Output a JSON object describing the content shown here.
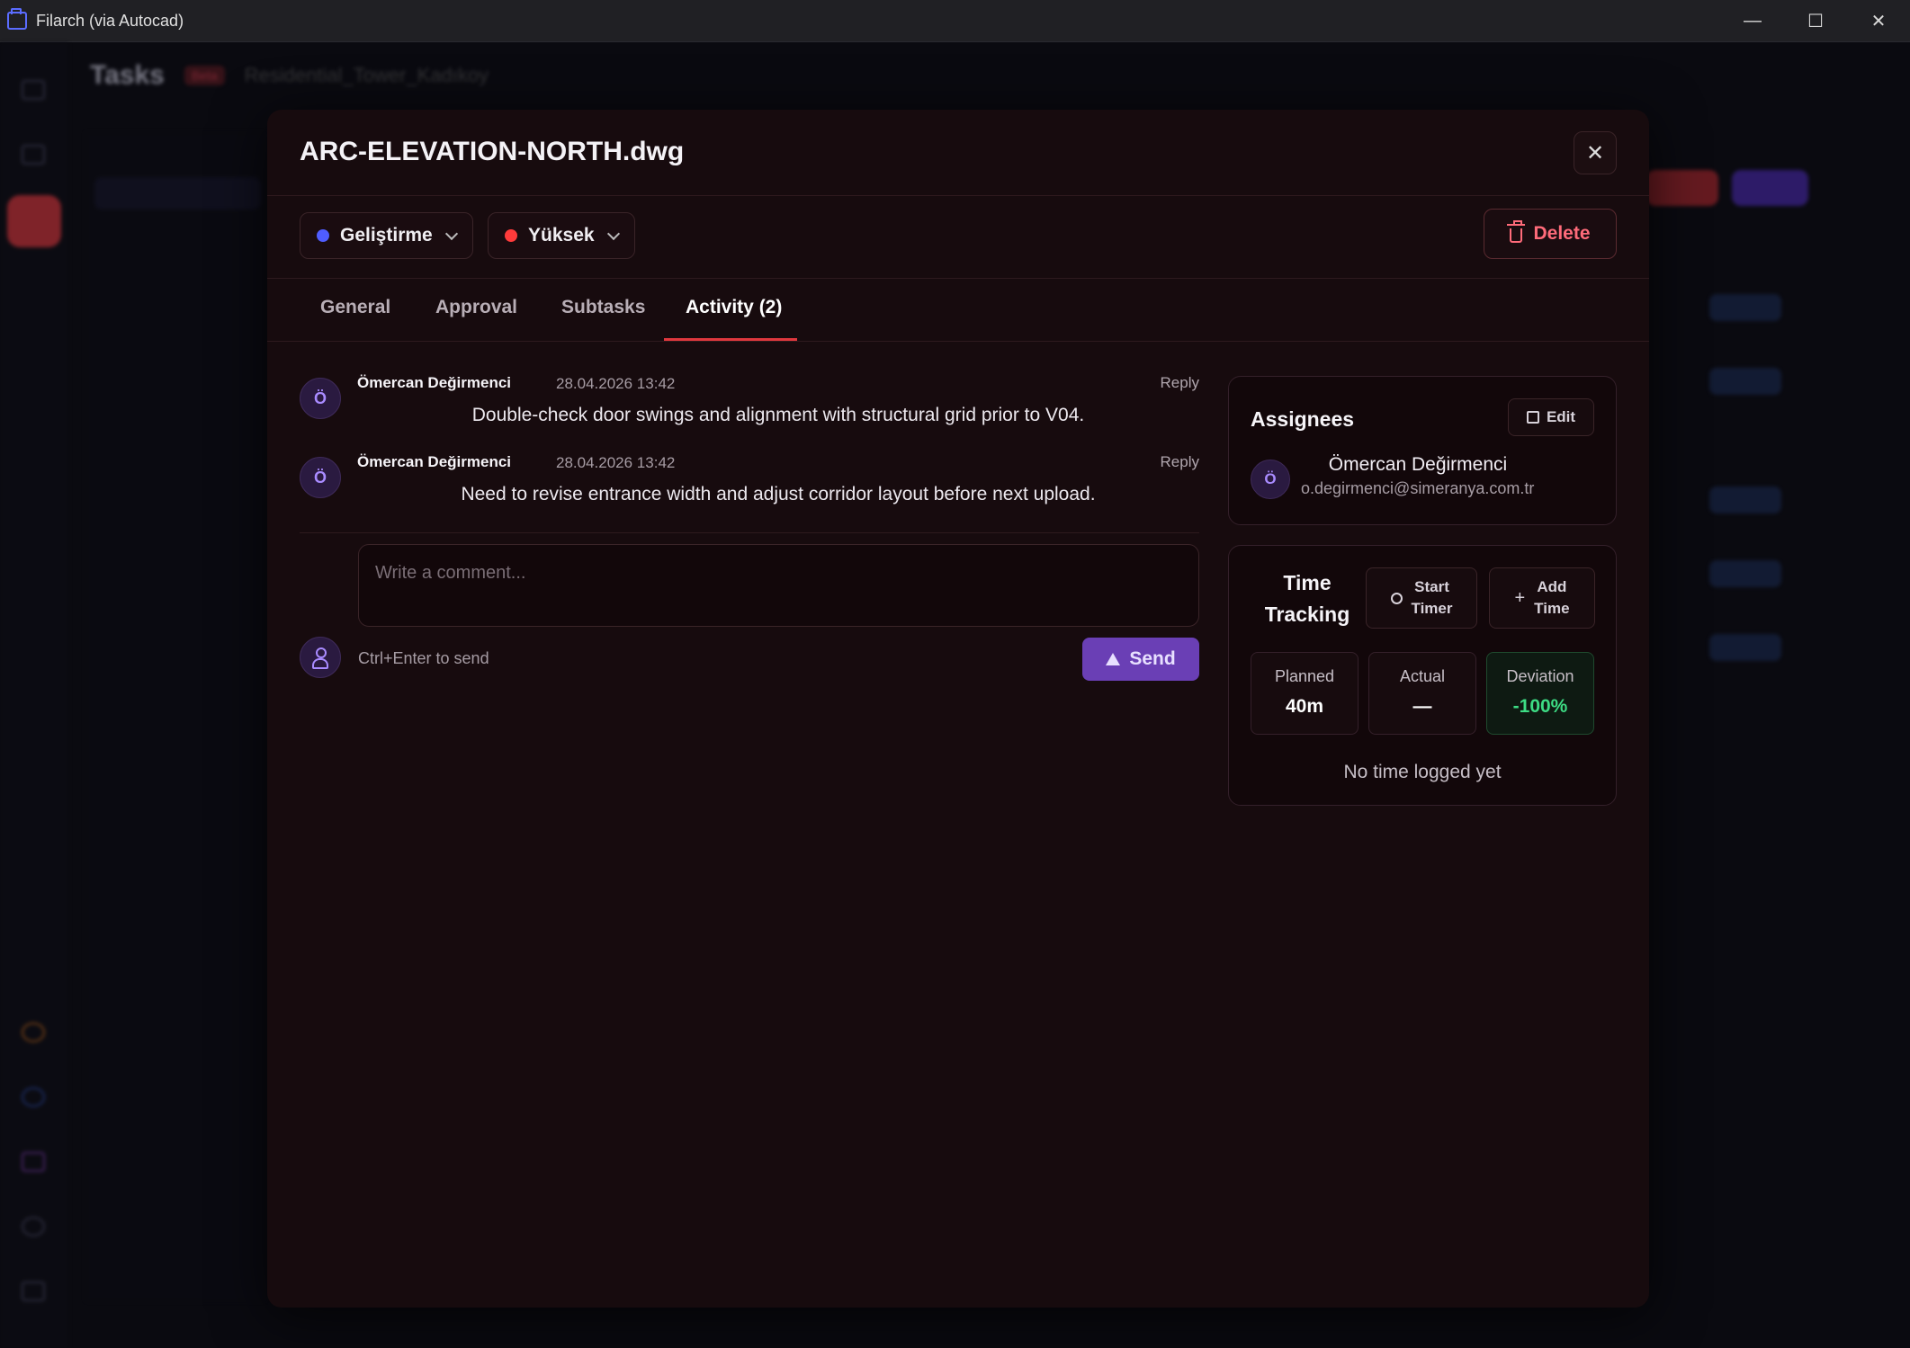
{
  "window": {
    "title": "Filarch (via Autocad)",
    "controls": {
      "minimize": "—",
      "maximize": "☐",
      "close": "✕"
    }
  },
  "background": {
    "page_title": "Tasks",
    "badge": "Beta",
    "project": "Residential_Tower_Kadıkoy"
  },
  "modal": {
    "title": "ARC-ELEVATION-NORTH.dwg",
    "close_label": "✕",
    "status": {
      "label": "Geliştirme",
      "color": "#4f5dff"
    },
    "priority": {
      "label": "Yüksek",
      "color": "#ff3b3b"
    },
    "delete_label": "Delete",
    "tabs": [
      {
        "label": "General"
      },
      {
        "label": "Approval"
      },
      {
        "label": "Subtasks"
      },
      {
        "label": "Activity (2)"
      }
    ],
    "active_tab": "Activity (2)"
  },
  "activity": {
    "comments": [
      {
        "initial": "Ö",
        "author": "Ömercan Değirmenci",
        "time": "28.04.2026 13:42",
        "text": "Double-check door swings and alignment with structural grid prior to V04.",
        "reply_label": "Reply"
      },
      {
        "initial": "Ö",
        "author": "Ömercan Değirmenci",
        "time": "28.04.2026 13:42",
        "text": "Need to revise entrance width and adjust corridor layout before next upload.",
        "reply_label": "Reply"
      }
    ],
    "input_placeholder": "Write a comment...",
    "hint": "Ctrl+Enter to send",
    "send_label": "Send"
  },
  "assignees": {
    "title": "Assignees",
    "edit_label": "Edit",
    "people": [
      {
        "initial": "Ö",
        "name": "Ömercan Değirmenci",
        "email": "o.degirmenci@simeranya.com.tr"
      }
    ]
  },
  "time_tracking": {
    "title_line1": "Time",
    "title_line2": "Tracking",
    "start_timer": {
      "line1": "Start",
      "line2": "Timer"
    },
    "add_time": {
      "line1": "Add",
      "line2": "Time"
    },
    "stats": [
      {
        "label": "Planned",
        "value": "40m"
      },
      {
        "label": "Actual",
        "value": "—"
      },
      {
        "label": "Deviation",
        "value": "-100%"
      }
    ],
    "empty_text": "No time logged yet"
  },
  "colors": {
    "accent": "#e0383e",
    "send_button": "#6a3fb5",
    "deviation_positive": "#3ddc84",
    "delete": "#ff6b7a"
  }
}
